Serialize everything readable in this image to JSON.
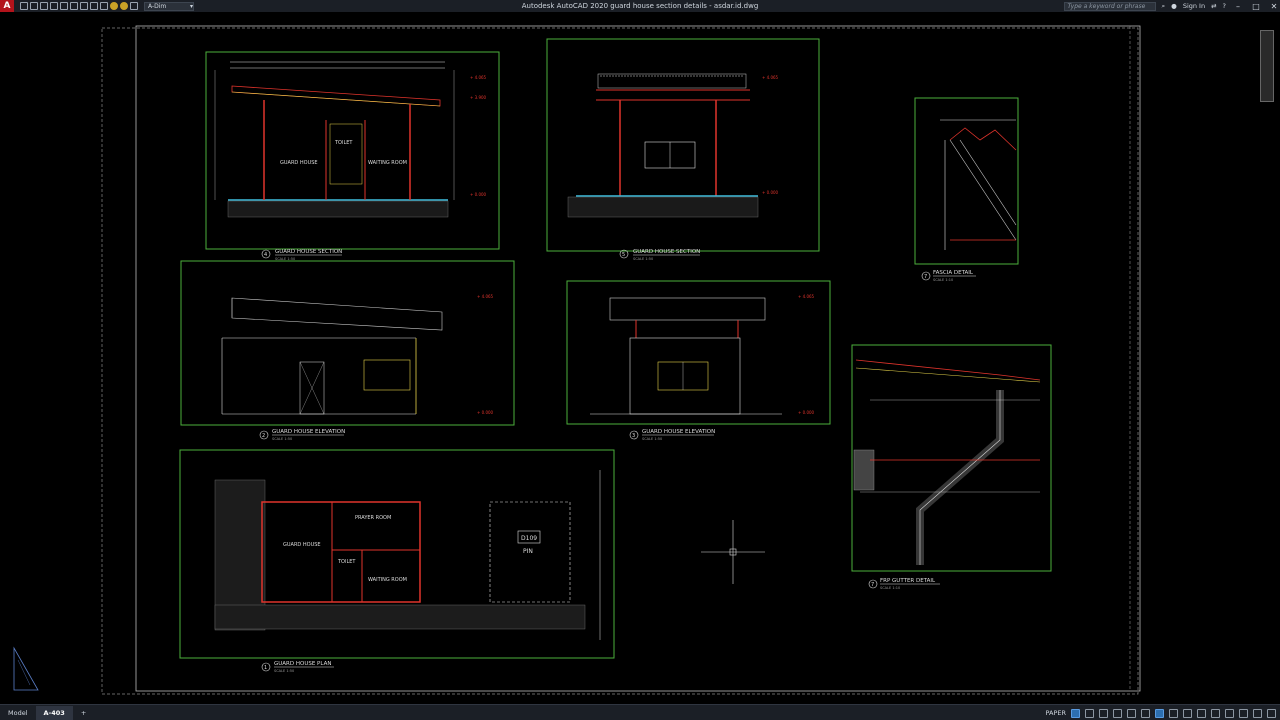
{
  "titlebar": {
    "app_letter": "A",
    "workspace": "A-Dim",
    "title": "Autodesk AutoCAD 2020   guard house section details - asdar.id.dwg",
    "search_placeholder": "Type a keyword or phrase",
    "sign_in": "Sign In"
  },
  "drawing": {
    "section1": {
      "label": "GUARD HOUSE SECTION",
      "scale": "SCALE 1:50",
      "num": "4",
      "rooms": [
        "TOILET",
        "GUARD HOUSE",
        "WAITING ROOM"
      ]
    },
    "section2": {
      "label": "GUARD HOUSE SECTION",
      "scale": "SCALE 1:50",
      "num": "5"
    },
    "fascia": {
      "label": "FASCIA DETAIL",
      "scale": "SCALE 1:10",
      "num": "7"
    },
    "elev1": {
      "label": "GUARD HOUSE ELEVATION",
      "scale": "SCALE 1:50",
      "num": "2"
    },
    "elev2": {
      "label": "GUARD HOUSE ELEVATION",
      "scale": "SCALE 1:50",
      "num": "3"
    },
    "gutter": {
      "label": "FRP GUTTER DETAIL",
      "scale": "SCALE 1:10",
      "num": "7"
    },
    "plan": {
      "label": "GUARD HOUSE PLAN",
      "scale": "SCALE 1:50",
      "num": "1",
      "rooms": [
        "PRAYER ROOM",
        "GUARD HOUSE",
        "TOILET",
        "WAITING ROOM"
      ],
      "tag": "D109",
      "tag2": "PIN"
    },
    "levels": [
      "+ 4.065",
      "+ 3.900",
      "+ 0.000"
    ],
    "level_notes": [
      "TOP OF CONCRETE",
      "FFL"
    ]
  },
  "statusbar": {
    "tabs": [
      "Model",
      "A-403"
    ],
    "paper": "PAPER",
    "plus": "+"
  },
  "colors": {
    "frame": "#4caf3c",
    "red": "#e0342c",
    "yellow": "#e6d34a",
    "cyan": "#3fbfe0",
    "white": "#e9e9e9"
  }
}
